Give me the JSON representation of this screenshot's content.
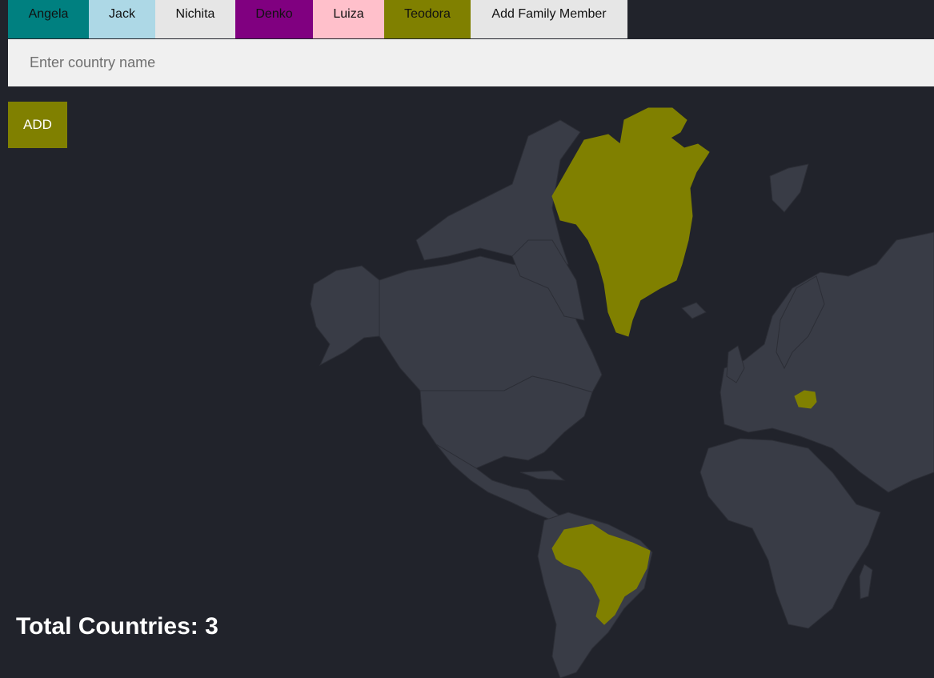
{
  "tabs": [
    {
      "label": "Angela",
      "color": "#008080"
    },
    {
      "label": "Jack",
      "color": "#add8e6"
    },
    {
      "label": "Nichita",
      "color": "#e6e6e6"
    },
    {
      "label": "Denko",
      "color": "#800080"
    },
    {
      "label": "Luiza",
      "color": "#ffc0cb"
    },
    {
      "label": "Teodora",
      "color": "#808000"
    }
  ],
  "add_member_label": "Add Family Member",
  "country_input": {
    "placeholder": "Enter country name",
    "value": ""
  },
  "add_button": {
    "label": "ADD",
    "color": "#808000"
  },
  "map": {
    "land_color": "#393c46",
    "highlight_color": "#808000",
    "visited_countries": [
      "Greenland",
      "Romania",
      "Brazil"
    ]
  },
  "total_label": "Total Countries: 3"
}
